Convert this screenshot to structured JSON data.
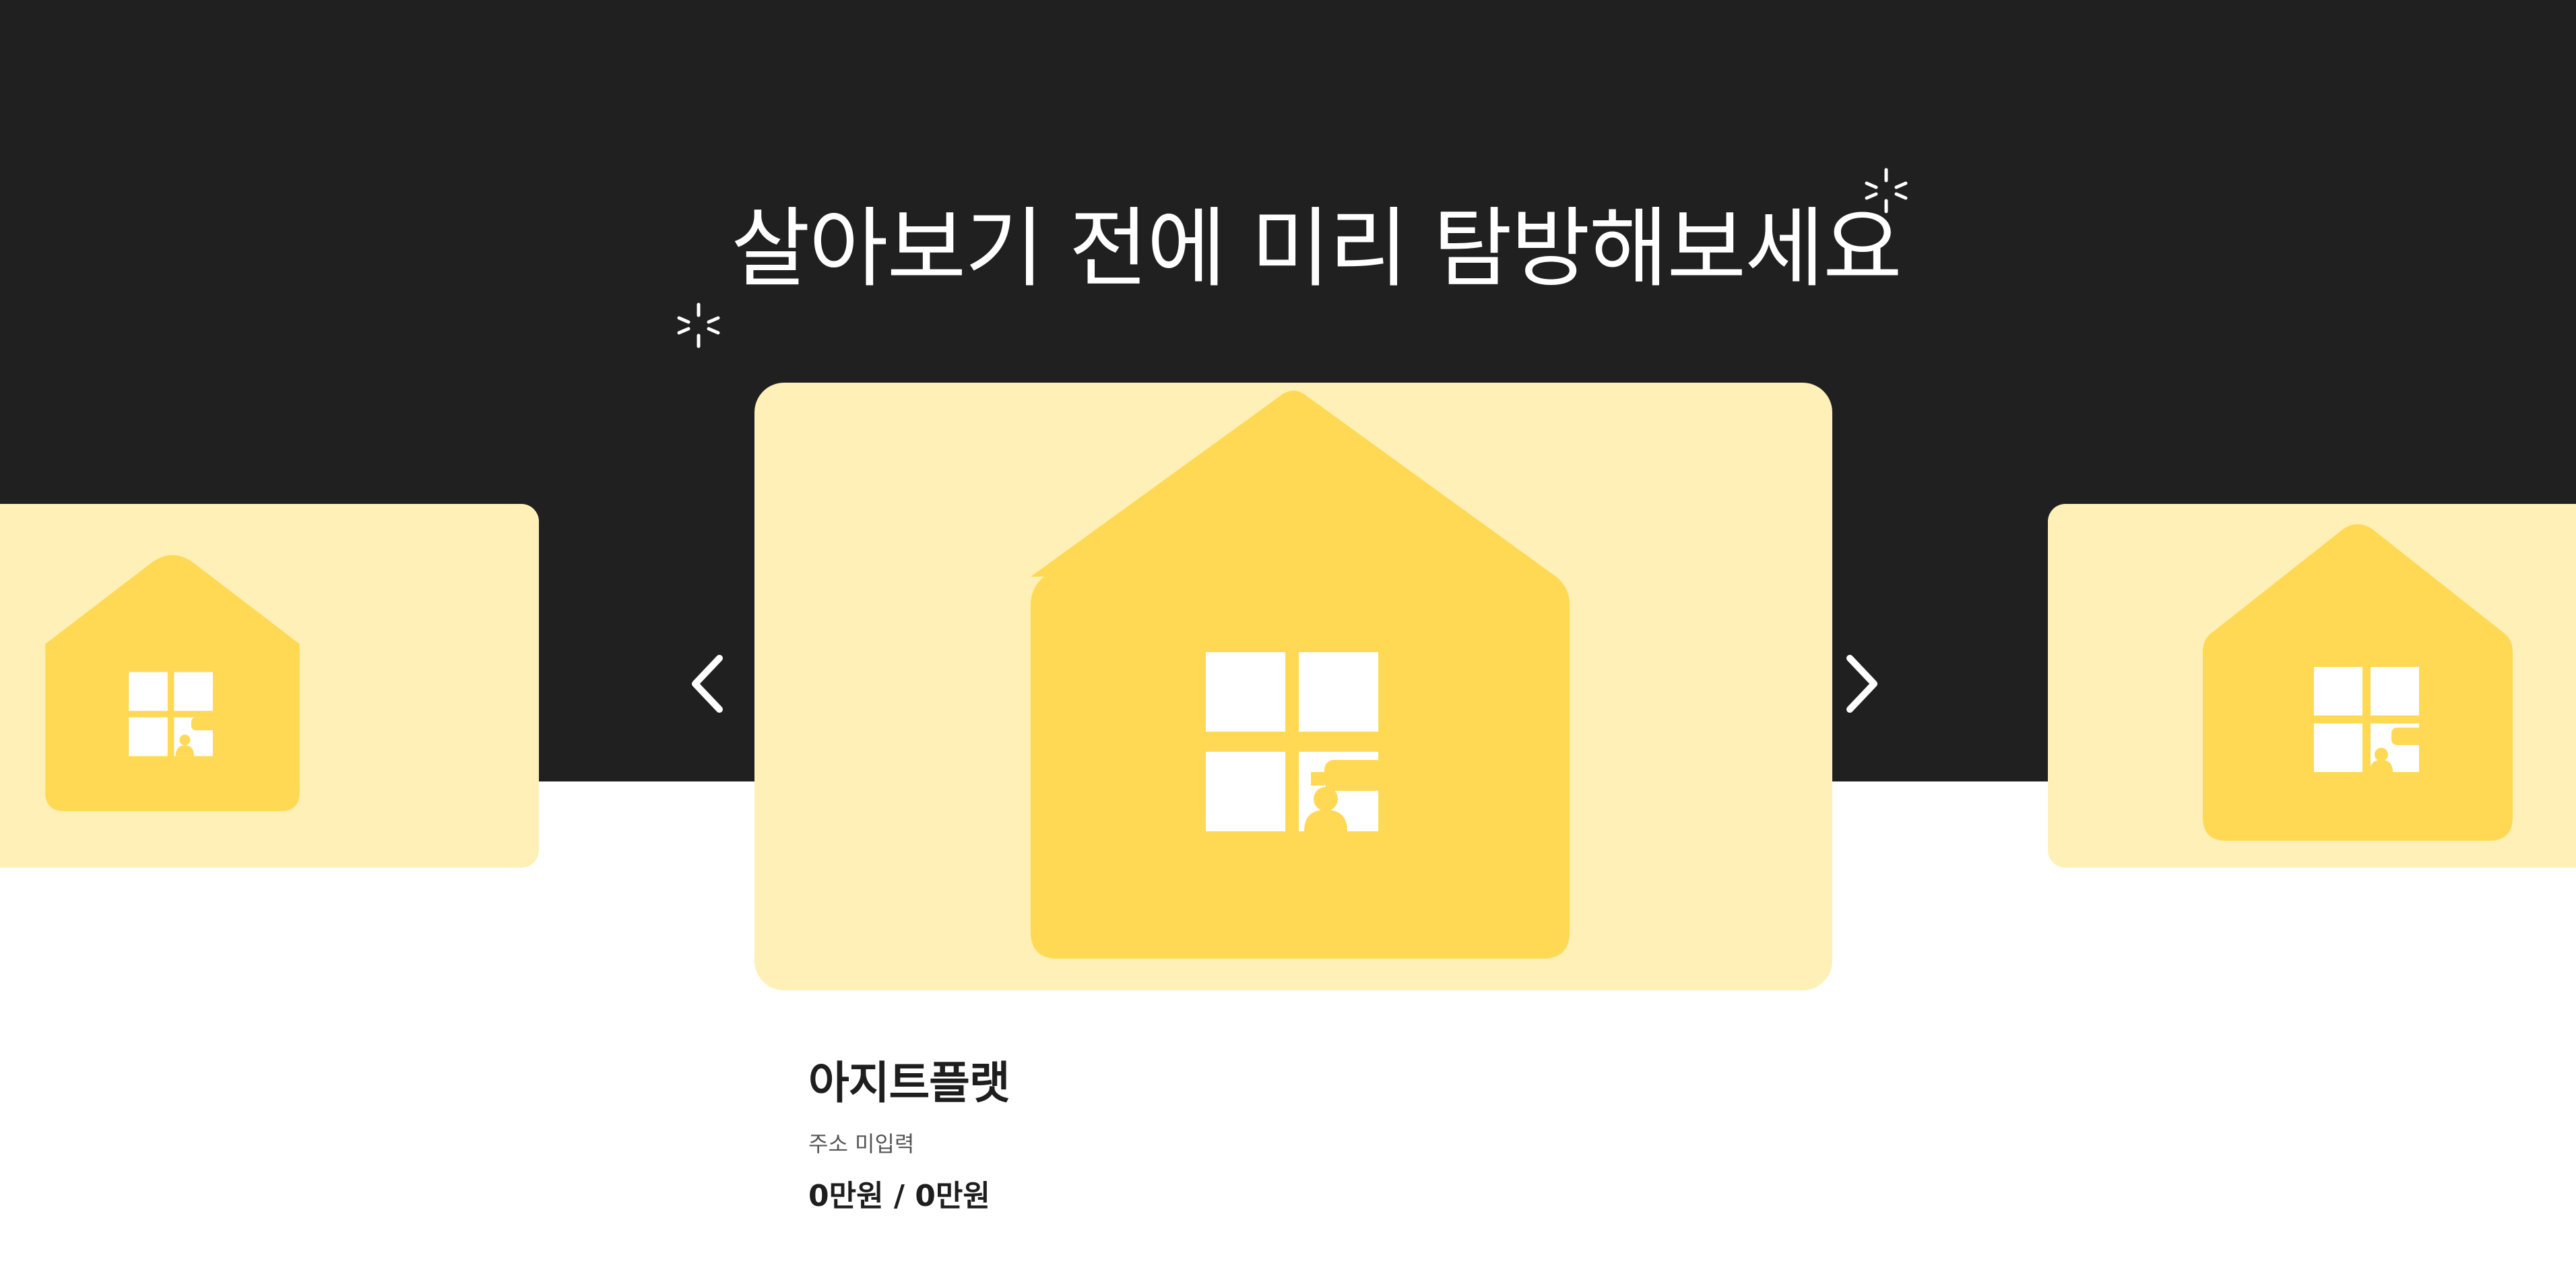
{
  "hero": {
    "headline": "살아보기 전에 미리 탐방해보세요"
  },
  "carousel": {
    "prev_icon": "chevron-left-icon",
    "next_icon": "chevron-right-icon",
    "current": {
      "name": "아지트플랫",
      "address": "주소 미입력",
      "price": "0만원 / 0만원"
    }
  },
  "colors": {
    "dark_background": "#202020",
    "card_background": "#fef0b6",
    "house": "#ffd954",
    "text_dark": "#1e1e1e",
    "text_muted": "#555555"
  }
}
